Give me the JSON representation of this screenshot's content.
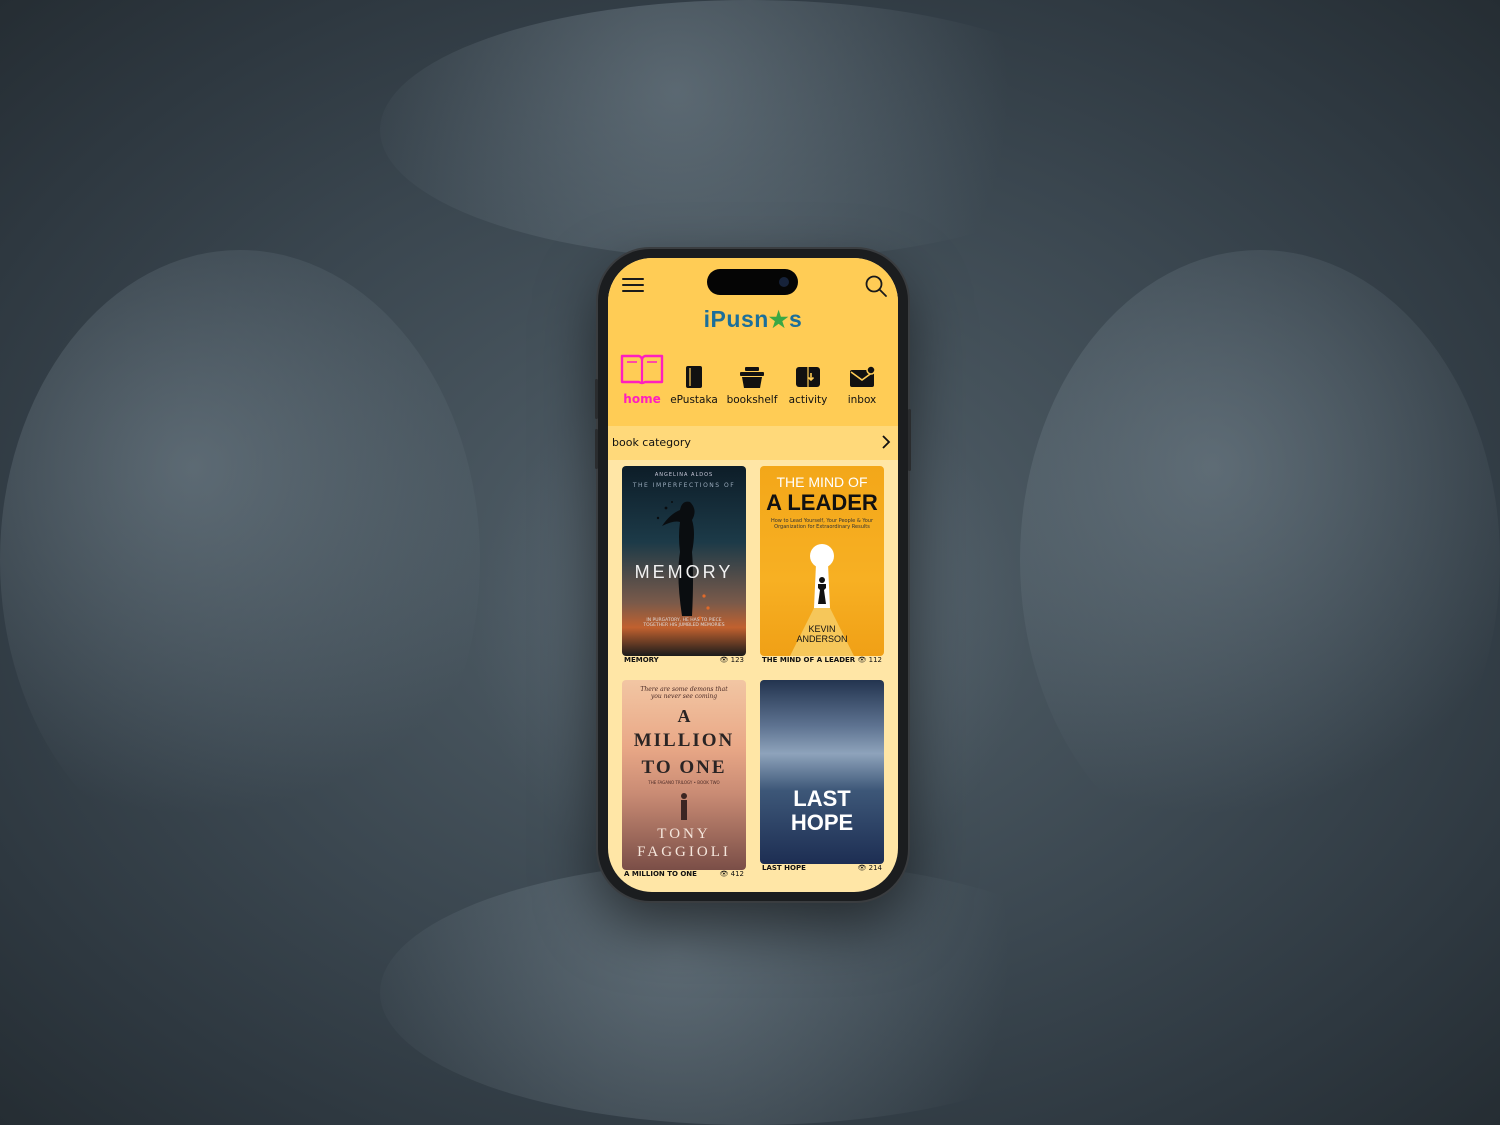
{
  "app": {
    "logo": "iPusn",
    "logo_star": "★",
    "logo_tail": "s"
  },
  "nav": [
    {
      "label": "home",
      "icon": "open-book-icon",
      "active": true
    },
    {
      "label": "ePustaka",
      "icon": "book-icon",
      "active": false
    },
    {
      "label": "bookshelf",
      "icon": "basket-icon",
      "active": false
    },
    {
      "label": "activity",
      "icon": "book-download-icon",
      "active": false
    },
    {
      "label": "inbox",
      "icon": "mail-icon",
      "active": false
    }
  ],
  "category_bar": {
    "label": "book category"
  },
  "books": [
    {
      "title": "MEMORY",
      "views": "123",
      "cover": {
        "author": "ANGELINA ALDOS",
        "subtitle": "THE IMPERFECTIONS OF",
        "main": "MEMORY",
        "tagline": "IN PURGATORY, HE HAS TO PIECE TOGETHER HIS JUMBLED MEMORIES"
      }
    },
    {
      "title": "THE MIND OF A LEADER",
      "views": "112",
      "cover": {
        "line1": "THE MIND OF",
        "line2": "A LEADER",
        "subtitle": "How to Lead Yourself, Your People & Your Organization for Extraordinary Results",
        "author1": "KEVIN",
        "author2": "ANDERSON"
      }
    },
    {
      "title": "A MILLION TO ONE",
      "views": "412",
      "cover": {
        "tagline": "There are some demons that you never see coming",
        "line1": "A",
        "line2": "MILLION",
        "line3": "TO ONE",
        "series": "THE FAGANO TRILOGY • BOOK TWO",
        "author1": "TONY",
        "author2": "FAGGIOLI"
      }
    },
    {
      "title": "LAST HOPE",
      "views": "214",
      "cover": {
        "line1": "LAST",
        "line2": "HOPE"
      }
    }
  ]
}
